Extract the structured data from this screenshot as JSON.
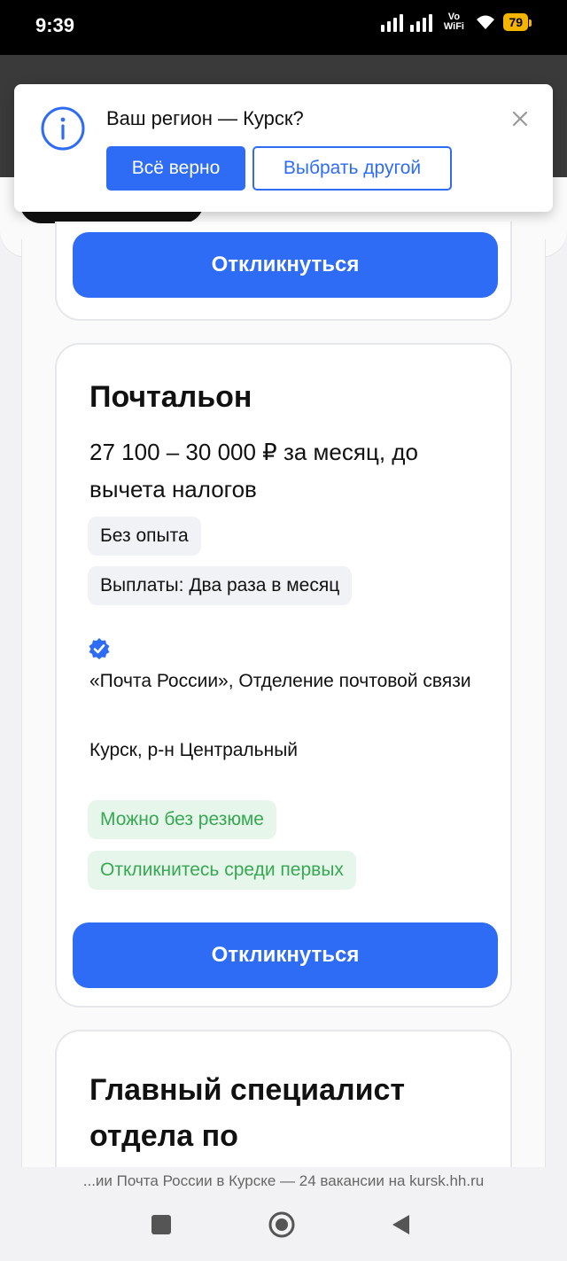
{
  "status_bar": {
    "time": "9:39",
    "network": "Vo WiFi",
    "battery": "79"
  },
  "region_popup": {
    "question": "Ваш регион — Курск?",
    "confirm_label": "Всё верно",
    "choose_other_label": "Выбрать другой"
  },
  "previous_card": {
    "apply_label": "Откликнуться"
  },
  "vacancy": {
    "title": "Почтальон",
    "salary": "27 100 – 30 000 ₽ за месяц, до вычета налогов",
    "tags": [
      "Без опыта",
      "Выплаты: Два раза в месяц"
    ],
    "company": "«Почта России», Отделение почтовой связи",
    "location": "Курск, р-н Центральный",
    "badges": [
      "Можно без резюме",
      "Откликнитесь среди первых"
    ],
    "apply_label": "Откликнуться"
  },
  "next_vacancy": {
    "title": "Главный специалист отдела по"
  },
  "browser": {
    "page_title": "...ии Почта России в Курске — 24 вакансии на kursk.hh.ru"
  },
  "colors": {
    "accent": "#2e6cf6",
    "green_badge": "#37a853",
    "battery": "#f5b400"
  }
}
